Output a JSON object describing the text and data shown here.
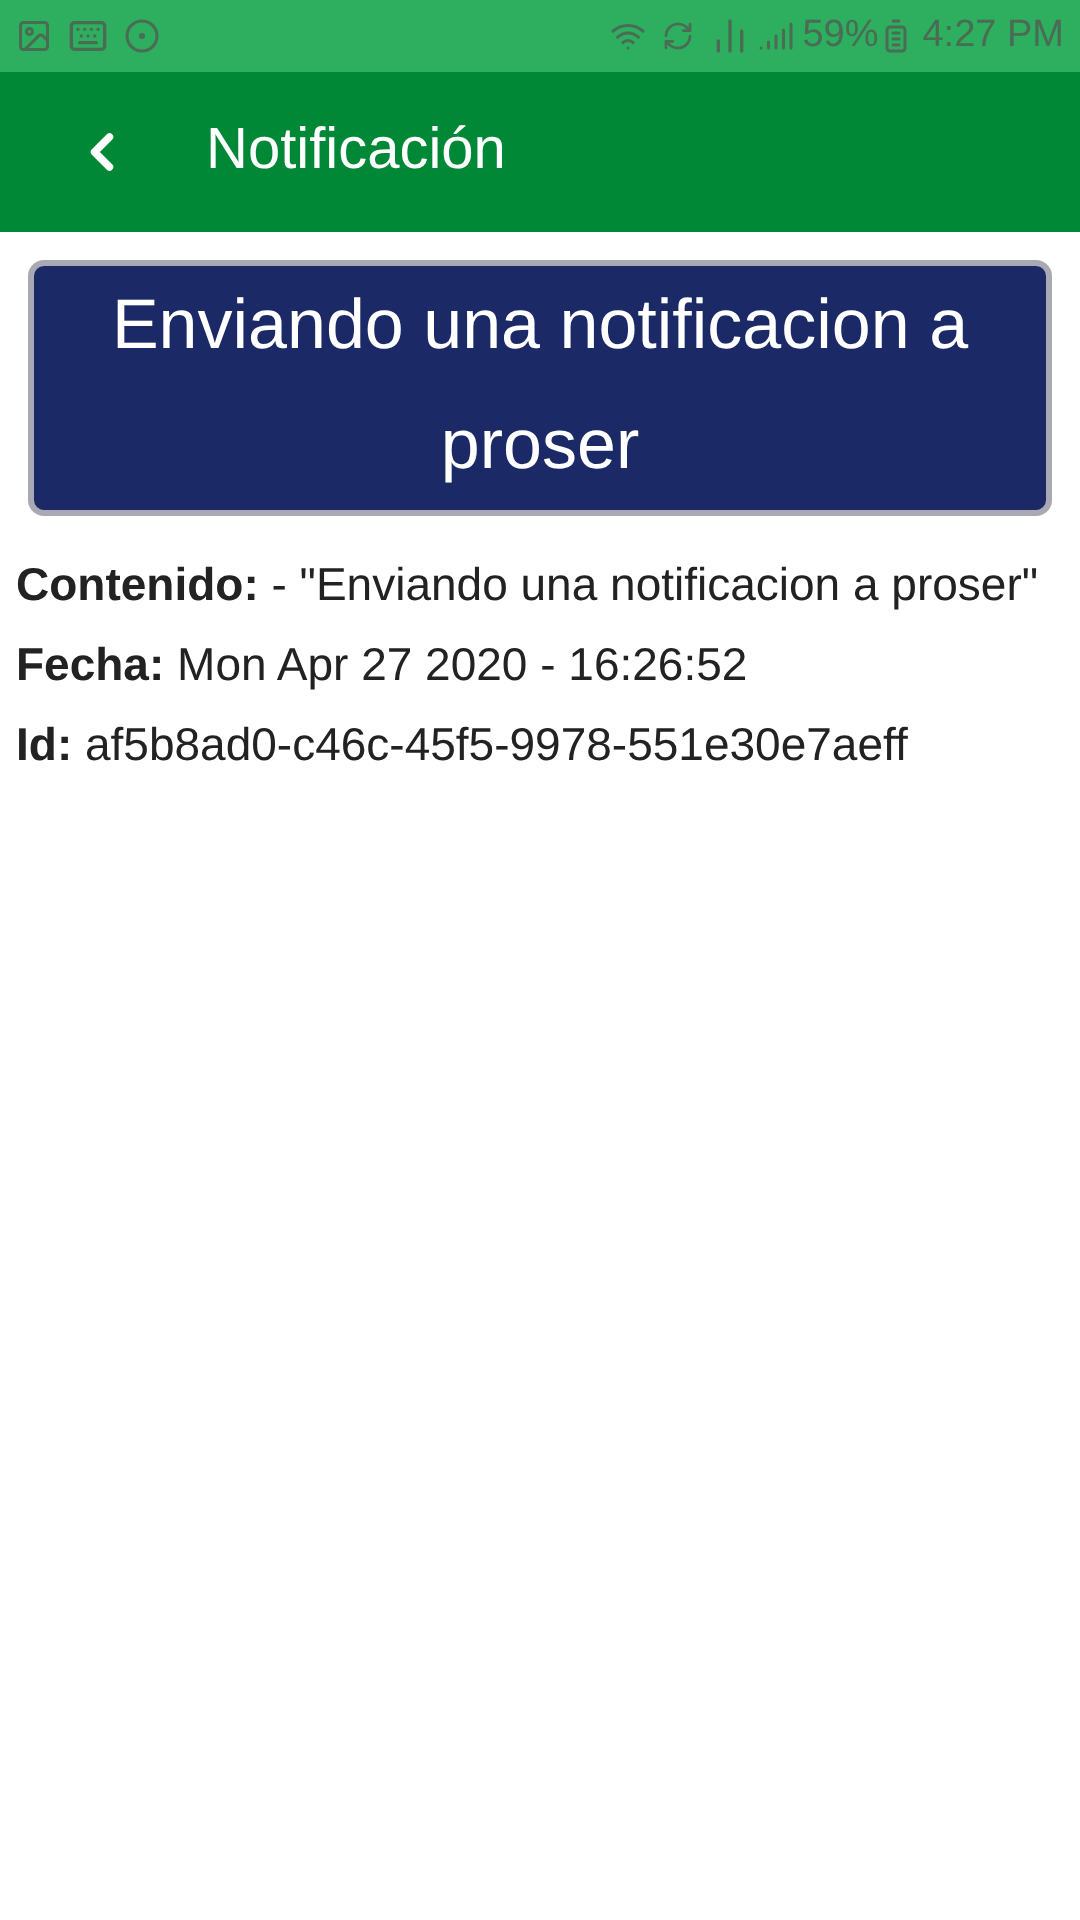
{
  "status_bar": {
    "battery_text": "59%",
    "time": "4:27 PM"
  },
  "app_bar": {
    "title": "Notificación"
  },
  "banner": {
    "text": "Enviando una notificacion a proser"
  },
  "details": [
    {
      "text": "**Contenido:** - \"Enviando una notificacion a proser\""
    },
    {
      "text": "**Fecha:** Mon Apr 27 2020 - 16:26:52"
    },
    {
      "text": "**Id:** af5b8ad0-c46c-45f5-9978-551e30e7aeff"
    }
  ]
}
